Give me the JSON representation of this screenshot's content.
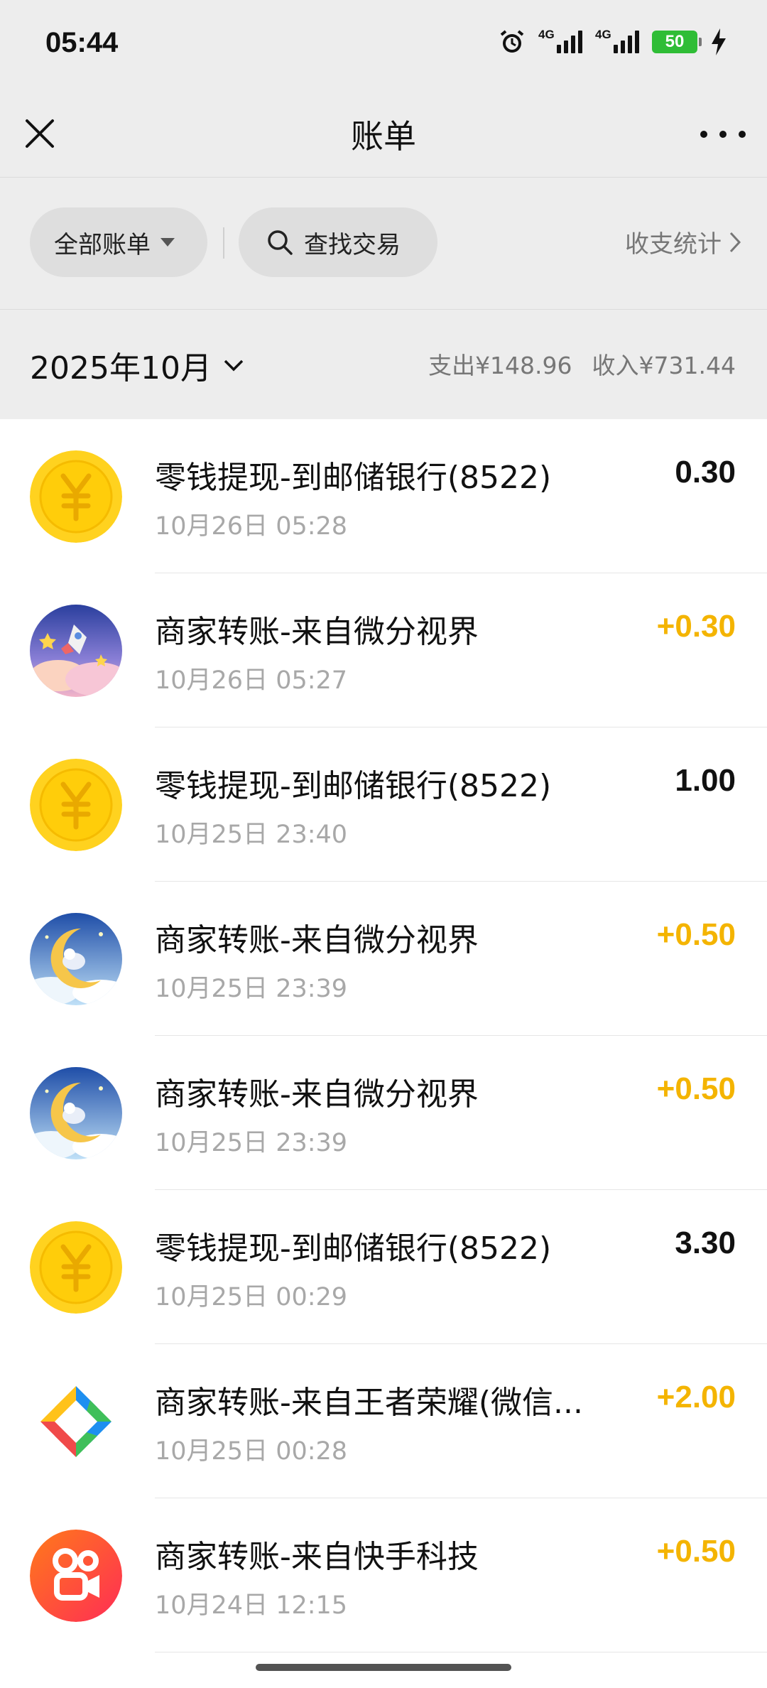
{
  "status_bar": {
    "time": "05:44",
    "network_1": "4G",
    "network_2": "4G",
    "battery": "50"
  },
  "header": {
    "title": "账单"
  },
  "filters": {
    "all_bills": "全部账单",
    "search": "查找交易",
    "stats": "收支统计"
  },
  "month": {
    "label": "2025年10月",
    "expense": "支出¥148.96",
    "income": "收入¥731.44"
  },
  "colors": {
    "income_amount": "#f4b400",
    "coin_yellow": "#ffd21f",
    "background_gray": "#ededed"
  },
  "transactions": [
    {
      "title": "零钱提现-到邮储银行(8522)",
      "time": "10月26日 05:28",
      "amount": "0.30",
      "icon": "yuan-coin-icon"
    },
    {
      "title": "商家转账-来自微分视界",
      "time": "10月26日 05:27",
      "amount": "+0.30",
      "icon": "rocket-sky-avatar"
    },
    {
      "title": "零钱提现-到邮储银行(8522)",
      "time": "10月25日 23:40",
      "amount": "1.00",
      "icon": "yuan-coin-icon"
    },
    {
      "title": "商家转账-来自微分视界",
      "time": "10月25日 23:39",
      "amount": "+0.50",
      "icon": "moon-night-avatar"
    },
    {
      "title": "商家转账-来自微分视界",
      "time": "10月25日 23:39",
      "amount": "+0.50",
      "icon": "moon-night-avatar"
    },
    {
      "title": "零钱提现-到邮储银行(8522)",
      "time": "10月25日 00:29",
      "amount": "3.30",
      "icon": "yuan-coin-icon"
    },
    {
      "title": "商家转账-来自王者荣耀(微信...",
      "time": "10月25日 00:28",
      "amount": "+2.00",
      "icon": "tencent-games-logo"
    },
    {
      "title": "商家转账-来自快手科技",
      "time": "10月24日 12:15",
      "amount": "+0.50",
      "icon": "kuaishou-logo"
    }
  ]
}
